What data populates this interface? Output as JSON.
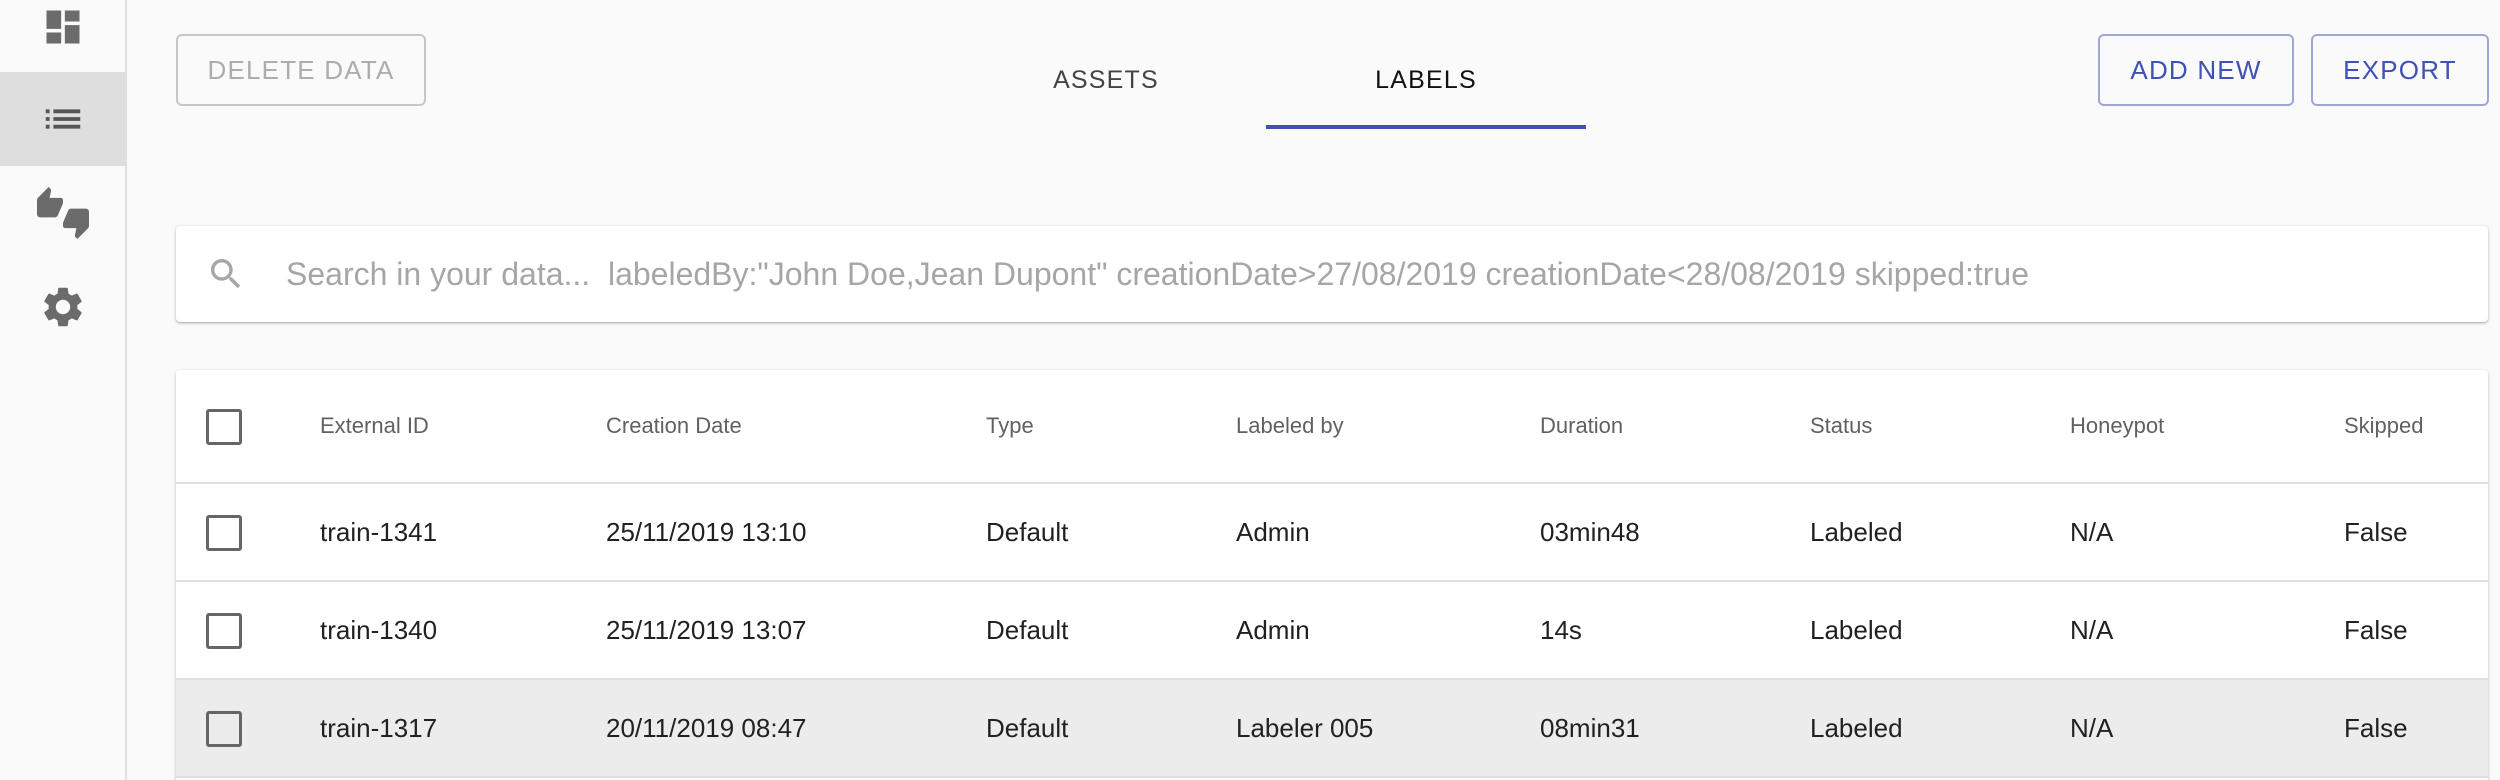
{
  "sidebar": {
    "items": [
      {
        "icon": "dashboard-icon",
        "active": false
      },
      {
        "icon": "list-icon",
        "active": true
      },
      {
        "icon": "thumbs-up-down-icon",
        "active": false
      },
      {
        "icon": "gear-icon",
        "active": false
      }
    ]
  },
  "toolbar": {
    "delete_label": "DELETE DATA",
    "add_label": "ADD NEW",
    "export_label": "EXPORT"
  },
  "tabs": [
    {
      "label": "ASSETS",
      "active": false
    },
    {
      "label": "LABELS",
      "active": true
    }
  ],
  "search": {
    "placeholder": "Search in your data...  labeledBy:\"John Doe,Jean Dupont\" creationDate>27/08/2019 creationDate<28/08/2019 skipped:true",
    "value": ""
  },
  "table": {
    "columns": [
      "External ID",
      "Creation Date",
      "Type",
      "Labeled by",
      "Duration",
      "Status",
      "Honeypot",
      "Skipped"
    ],
    "rows": [
      [
        "train-1341",
        "25/11/2019 13:10",
        "Default",
        "Admin",
        "03min48",
        "Labeled",
        "N/A",
        "False"
      ],
      [
        "train-1340",
        "25/11/2019 13:07",
        "Default",
        "Admin",
        "14s",
        "Labeled",
        "N/A",
        "False"
      ],
      [
        "train-1317",
        "20/11/2019 08:47",
        "Default",
        "Labeler 005",
        "08min31",
        "Labeled",
        "N/A",
        "False"
      ]
    ]
  },
  "colors": {
    "accent": "#3f51b5",
    "sidebar_active": "#dedede",
    "hover_row": "#ececec"
  }
}
